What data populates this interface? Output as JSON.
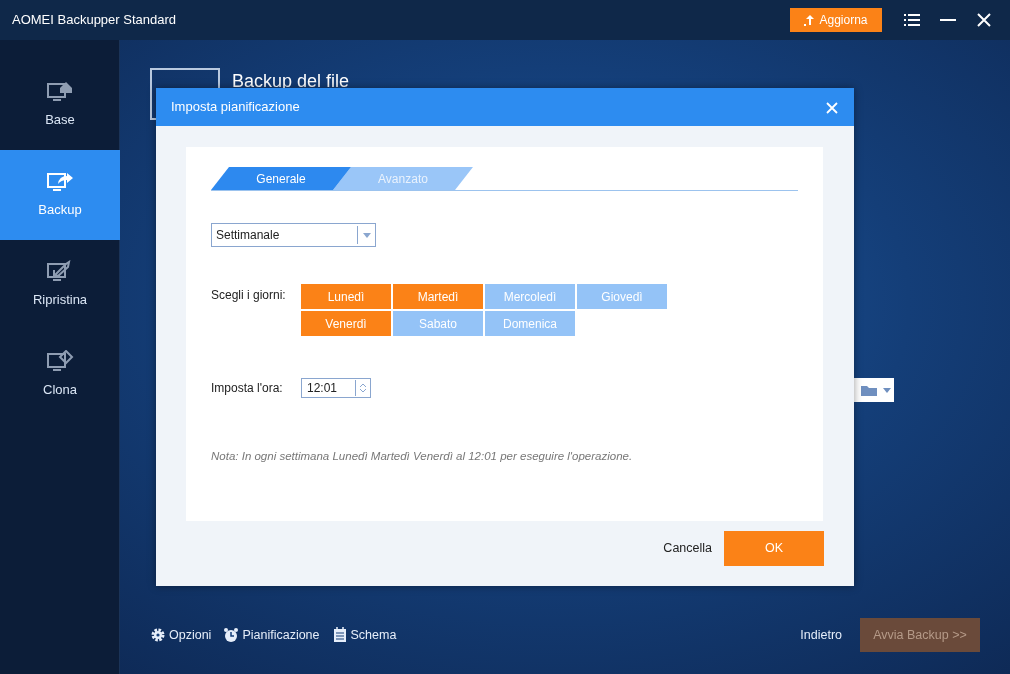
{
  "window": {
    "title": "AOMEI Backupper Standard",
    "upgrade_button": "Aggiorna"
  },
  "sidebar": {
    "items": [
      {
        "label": "Base",
        "kind": "home",
        "selected": false
      },
      {
        "label": "Backup",
        "kind": "share",
        "selected": true
      },
      {
        "label": "Ripristina",
        "kind": "restore",
        "selected": false
      },
      {
        "label": "Clona",
        "kind": "clone",
        "selected": false
      }
    ]
  },
  "page": {
    "title": "Backup del file"
  },
  "dialog": {
    "title": "Imposta pianificazione",
    "tabs": [
      {
        "label": "Generale",
        "selected": true
      },
      {
        "label": "Avanzato",
        "selected": false
      }
    ],
    "frequency": "Settimanale",
    "days_label": "Scegli i giorni:",
    "days": [
      {
        "label": "Lunedì",
        "selected": true
      },
      {
        "label": "Martedì",
        "selected": true
      },
      {
        "label": "Mercoledì",
        "selected": false
      },
      {
        "label": "Giovedì",
        "selected": false
      },
      {
        "label": "Venerdì",
        "selected": true
      },
      {
        "label": "Sabato",
        "selected": false
      },
      {
        "label": "Domenica",
        "selected": false
      }
    ],
    "time_label": "Imposta l'ora:",
    "time": "12:01",
    "note": "Nota: In ogni settimana Lunedì Martedì Venerdì al 12:01 per eseguire l'operazione.",
    "cancel": "Cancella",
    "ok": "OK"
  },
  "toolbar": {
    "items": [
      {
        "label": "Opzioni",
        "kind": "gear"
      },
      {
        "label": "Pianificazione",
        "kind": "alarm"
      },
      {
        "label": "Schema",
        "kind": "list"
      }
    ],
    "back": "Indietro",
    "start": {
      "label": "Avvia Backup >>",
      "disabled": true
    }
  }
}
